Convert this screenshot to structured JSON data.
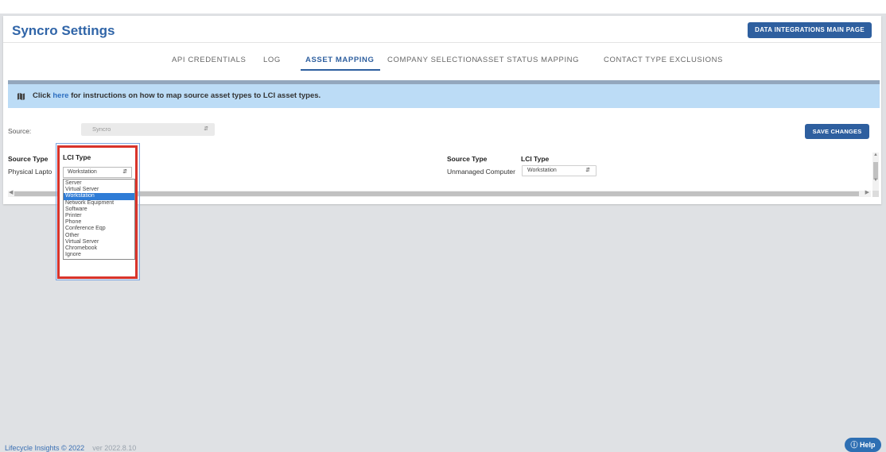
{
  "header": {
    "title": "Syncro Settings",
    "main_button": "DATA INTEGRATIONS MAIN PAGE"
  },
  "tabs": [
    {
      "label": "API CREDENTIALS",
      "active": false
    },
    {
      "label": "LOG",
      "active": false
    },
    {
      "label": "ASSET MAPPING",
      "active": true
    },
    {
      "label": "COMPANY SELECTION",
      "active": false
    },
    {
      "label": "ASSET STATUS MAPPING",
      "active": false
    },
    {
      "label": "CONTACT TYPE EXCLUSIONS",
      "active": false
    }
  ],
  "info": {
    "icon": "map-icon",
    "prefix": "Click ",
    "link": "here",
    "suffix": " for instructions on how to map source asset types to LCI asset types."
  },
  "source": {
    "label": "Source:",
    "value": "Syncro"
  },
  "save_label": "SAVE CHANGES",
  "table": {
    "left": {
      "source_type_header": "Source Type",
      "lci_type_header": "LCI Type",
      "row_source": "Physical Lapto",
      "row_lci": "Workstation"
    },
    "right": {
      "source_type_header": "Source Type",
      "lci_type_header": "LCI Type",
      "row_source": "Unmanaged Computer",
      "row_lci": "Workstation"
    }
  },
  "dropdown": {
    "selected": "Workstation",
    "options": [
      "Server",
      "Virtual Server",
      "Workstation",
      "Network Equipment",
      "Software",
      "Printer",
      "Phone",
      "Conference Eqp",
      "Other",
      "Virtual Server",
      "Chromebook",
      "Ignore"
    ]
  },
  "footer": {
    "brand": "Lifecycle Insights © 2022",
    "version": "ver 2022.8.10"
  },
  "help_label": "Help",
  "colors": {
    "accent": "#2e5f9f",
    "info_bg": "#bcdcf6",
    "highlight": "#d9342b",
    "selected_option": "#2f7cd6"
  }
}
